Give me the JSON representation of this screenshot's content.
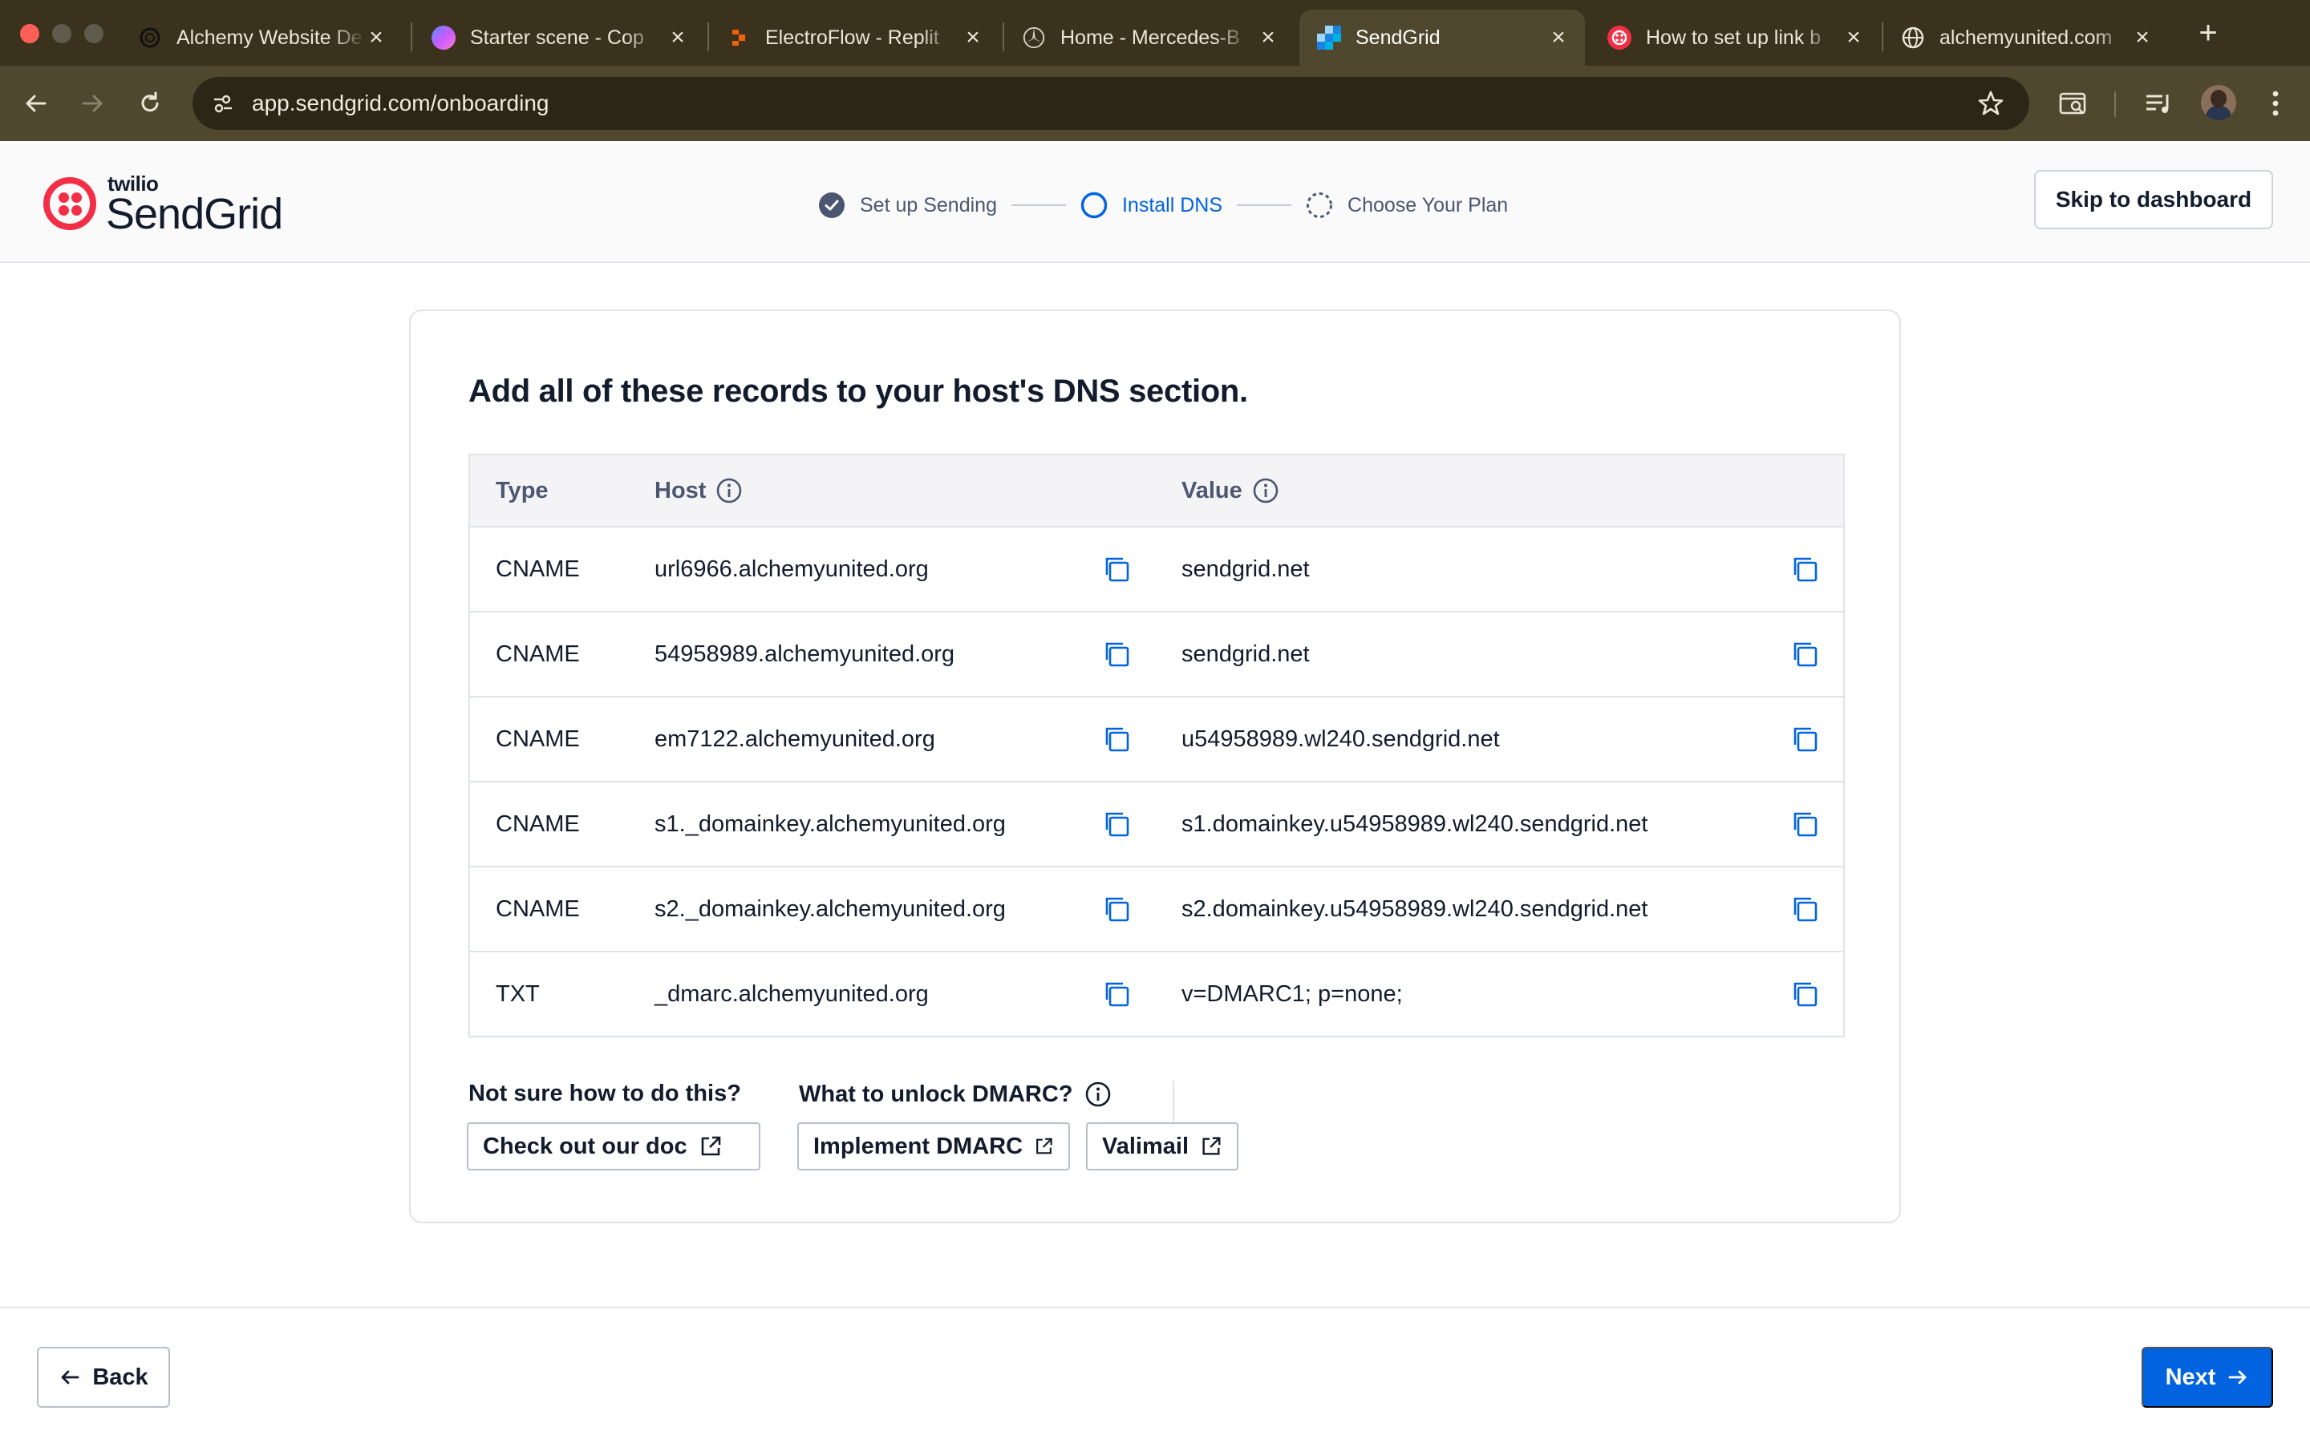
{
  "browser": {
    "tabs": [
      {
        "title": "Alchemy Website De",
        "favicon": "openai-icon",
        "active": false
      },
      {
        "title": "Starter scene - Cop",
        "favicon": "spline-icon",
        "active": false
      },
      {
        "title": "ElectroFlow - Replit",
        "favicon": "replit-icon",
        "active": false
      },
      {
        "title": "Home - Mercedes-B",
        "favicon": "mercedes-icon",
        "active": false
      },
      {
        "title": "SendGrid",
        "favicon": "sendgrid-icon",
        "active": true
      },
      {
        "title": "How to set up link b",
        "favicon": "twilio-icon",
        "active": false
      },
      {
        "title": "alchemyunited.com",
        "favicon": "globe-icon",
        "active": false
      }
    ],
    "url": "app.sendgrid.com/onboarding"
  },
  "header": {
    "brand_small": "twilio",
    "brand_large": "SendGrid",
    "steps": [
      {
        "label": "Set up Sending",
        "state": "complete"
      },
      {
        "label": "Install DNS",
        "state": "current"
      },
      {
        "label": "Choose Your Plan",
        "state": "upcoming"
      }
    ],
    "skip_label": "Skip to dashboard"
  },
  "main": {
    "title": "Add all of these records to your host's DNS section.",
    "columns": {
      "type": "Type",
      "host": "Host",
      "value": "Value"
    },
    "records": [
      {
        "type": "CNAME",
        "host": "url6966.alchemyunited.org",
        "value": "sendgrid.net"
      },
      {
        "type": "CNAME",
        "host": "54958989.alchemyunited.org",
        "value": "sendgrid.net"
      },
      {
        "type": "CNAME",
        "host": "em7122.alchemyunited.org",
        "value": "u54958989.wl240.sendgrid.net"
      },
      {
        "type": "CNAME",
        "host": "s1._domainkey.alchemyunited.org",
        "value": "s1.domainkey.u54958989.wl240.sendgrid.net"
      },
      {
        "type": "CNAME",
        "host": "s2._domainkey.alchemyunited.org",
        "value": "s2.domainkey.u54958989.wl240.sendgrid.net"
      },
      {
        "type": "TXT",
        "host": "_dmarc.alchemyunited.org",
        "value": "v=DMARC1; p=none;"
      }
    ],
    "help": {
      "not_sure_label": "Not sure how to do this?",
      "doc_button": "Check out our doc",
      "dmarc_label": "What to unlock DMARC?",
      "implement_button": "Implement DMARC",
      "valimail_button": "Valimail"
    }
  },
  "footer": {
    "back_label": "Back",
    "next_label": "Next"
  },
  "colors": {
    "accent": "#0263e0",
    "brand_red": "#f22f46",
    "chrome_bg": "#3a321c"
  }
}
